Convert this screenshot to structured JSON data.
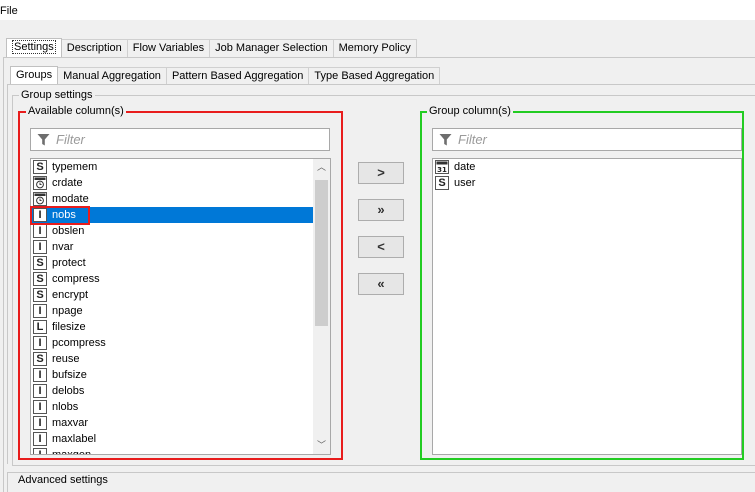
{
  "menu": {
    "file_label": "File"
  },
  "outer_tabs": [
    {
      "label": "Settings",
      "active": true
    },
    {
      "label": "Description"
    },
    {
      "label": "Flow Variables"
    },
    {
      "label": "Job Manager Selection"
    },
    {
      "label": "Memory Policy"
    }
  ],
  "inner_tabs": [
    {
      "label": "Groups",
      "active": true
    },
    {
      "label": "Manual Aggregation"
    },
    {
      "label": "Pattern Based Aggregation"
    },
    {
      "label": "Type Based Aggregation"
    }
  ],
  "group_settings": {
    "title": "Group settings"
  },
  "available": {
    "title": "Available column(s)",
    "filter_placeholder": "Filter",
    "columns": [
      {
        "name": "typemem",
        "type": "S",
        "icon": "string-type-icon"
      },
      {
        "name": "crdate",
        "type": "datetime",
        "icon": "datetime-type-icon"
      },
      {
        "name": "modate",
        "type": "datetime",
        "icon": "datetime-type-icon"
      },
      {
        "name": "nobs",
        "type": "I",
        "icon": "integer-type-icon",
        "selected": true
      },
      {
        "name": "obslen",
        "type": "I",
        "icon": "integer-type-icon"
      },
      {
        "name": "nvar",
        "type": "I",
        "icon": "integer-type-icon"
      },
      {
        "name": "protect",
        "type": "S",
        "icon": "string-type-icon"
      },
      {
        "name": "compress",
        "type": "S",
        "icon": "string-type-icon"
      },
      {
        "name": "encrypt",
        "type": "S",
        "icon": "string-type-icon"
      },
      {
        "name": "npage",
        "type": "I",
        "icon": "integer-type-icon"
      },
      {
        "name": "filesize",
        "type": "L",
        "icon": "long-type-icon"
      },
      {
        "name": "pcompress",
        "type": "I",
        "icon": "integer-type-icon"
      },
      {
        "name": "reuse",
        "type": "S",
        "icon": "string-type-icon"
      },
      {
        "name": "bufsize",
        "type": "I",
        "icon": "integer-type-icon"
      },
      {
        "name": "delobs",
        "type": "I",
        "icon": "integer-type-icon"
      },
      {
        "name": "nlobs",
        "type": "I",
        "icon": "integer-type-icon"
      },
      {
        "name": "maxvar",
        "type": "I",
        "icon": "integer-type-icon"
      },
      {
        "name": "maxlabel",
        "type": "I",
        "icon": "integer-type-icon"
      },
      {
        "name": "maxgen",
        "type": "I",
        "icon": "integer-type-icon"
      }
    ]
  },
  "buttons": {
    "add": ">",
    "add_all": "»",
    "remove": "<",
    "remove_all": "«"
  },
  "group": {
    "title": "Group column(s)",
    "filter_placeholder": "Filter",
    "columns": [
      {
        "name": "date",
        "type": "date",
        "icon": "calendar-type-icon",
        "icon_text": "31"
      },
      {
        "name": "user",
        "type": "S",
        "icon": "string-type-icon"
      }
    ]
  },
  "advanced": {
    "title": "Advanced settings"
  },
  "colors": {
    "highlight_red": "#e81c1c",
    "highlight_green": "#22cc22",
    "selection_blue": "#0078d7"
  }
}
